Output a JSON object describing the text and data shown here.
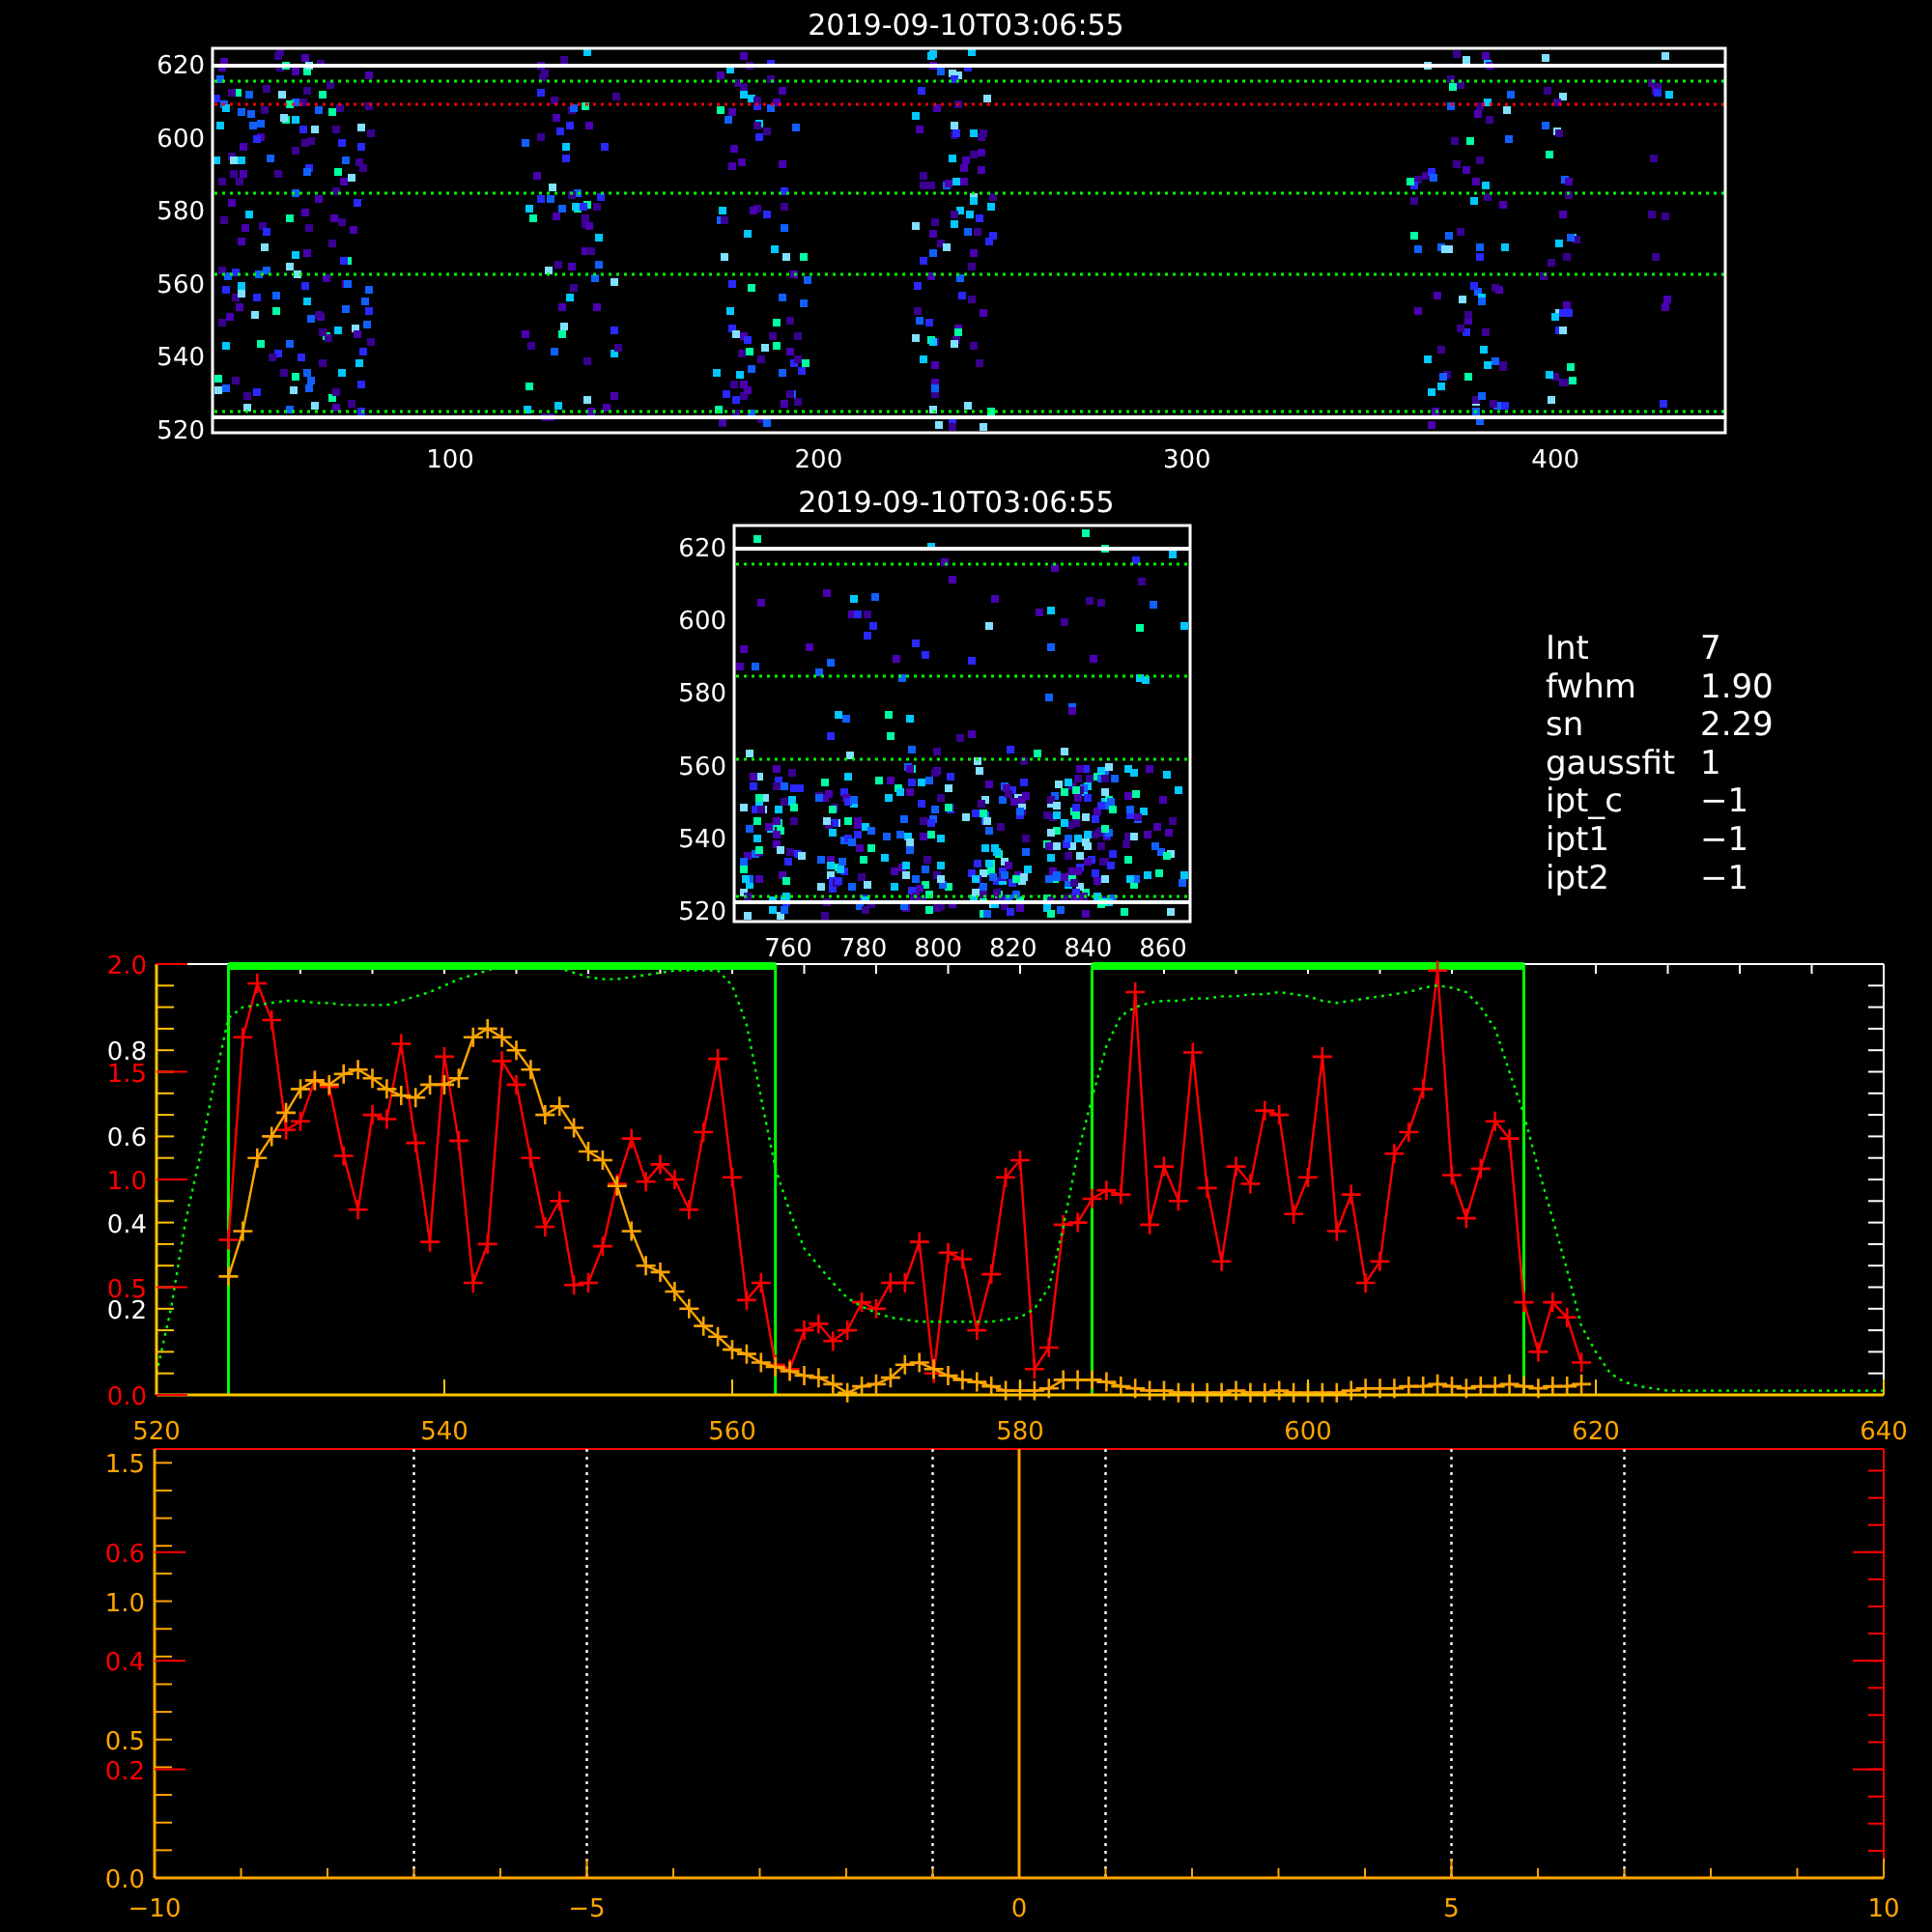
{
  "top_image": {
    "title": "2019-09-10T03:06:55",
    "x_tick_labels": [
      "100",
      "200",
      "300",
      "400"
    ],
    "y_tick_labels": [
      "620",
      "600",
      "580",
      "560",
      "540",
      "520"
    ],
    "guides": [
      {
        "color": "#ffffff",
        "kind": "solid"
      },
      {
        "color": "#00ff00",
        "kind": "dotted"
      },
      {
        "color": "#ff0000",
        "kind": "dotted"
      },
      {
        "color": "#00ff00",
        "kind": "dotted"
      },
      {
        "color": "#00ff00",
        "kind": "dotted"
      },
      {
        "color": "#00ff00",
        "kind": "dotted"
      },
      {
        "color": "#ffffff",
        "kind": "solid"
      }
    ]
  },
  "zoom_image": {
    "title": "2019-09-10T03:06:55",
    "x_tick_labels": [
      "760",
      "780",
      "800",
      "820",
      "840",
      "860"
    ],
    "y_tick_labels": [
      "620",
      "600",
      "580",
      "560",
      "540",
      "520"
    ],
    "guides": [
      {
        "color": "#ffffff",
        "kind": "solid"
      },
      {
        "color": "#00ff00",
        "kind": "dotted"
      },
      {
        "color": "#00ff00",
        "kind": "dotted"
      },
      {
        "color": "#00ff00",
        "kind": "dotted"
      },
      {
        "color": "#00ff00",
        "kind": "dotted"
      },
      {
        "color": "#ffffff",
        "kind": "solid"
      }
    ]
  },
  "fit_info": [
    {
      "label": "Int",
      "value": "7"
    },
    {
      "label": "fwhm",
      "value": "1.90"
    },
    {
      "label": "sn",
      "value": "2.29"
    },
    {
      "label": "gaussfit",
      "value": "1"
    },
    {
      "label": "ipt_c",
      "value": "−1"
    },
    {
      "label": "ipt1",
      "value": "−1"
    },
    {
      "label": "ipt2",
      "value": "−1"
    }
  ],
  "profile_plot": {
    "chart_data": {
      "type": "line",
      "xlim": [
        520,
        640
      ],
      "ylim": [
        0,
        2.0
      ],
      "y2lim": [
        0,
        1.0
      ],
      "xticks": [
        520,
        540,
        560,
        580,
        600,
        620,
        640
      ],
      "yticks": [
        {
          "value": 0,
          "label": "0.0"
        },
        {
          "value": 0.5,
          "label": "0.5"
        },
        {
          "value": 1.0,
          "label": "1.0"
        },
        {
          "value": 1.5,
          "label": "1.5"
        },
        {
          "value": 2.0,
          "label": "2.0"
        }
      ],
      "y2ticks": [
        {
          "value": 0.2,
          "label": "0.2"
        },
        {
          "value": 0.4,
          "label": "0.4"
        },
        {
          "value": 0.6,
          "label": "0.6"
        },
        {
          "value": 0.8,
          "label": "0.8"
        }
      ],
      "x": [
        520,
        521,
        522,
        523,
        524,
        525,
        526,
        527,
        528,
        529,
        530,
        531,
        532,
        533,
        534,
        535,
        536,
        537,
        538,
        539,
        540,
        541,
        542,
        543,
        544,
        545,
        546,
        547,
        548,
        549,
        550,
        551,
        552,
        553,
        554,
        555,
        556,
        557,
        558,
        559,
        560,
        561,
        562,
        563,
        564,
        565,
        566,
        567,
        568,
        569,
        570,
        571,
        572,
        573,
        574,
        575,
        576,
        577,
        578,
        579,
        580,
        581,
        582,
        583,
        584,
        585,
        586,
        587,
        588,
        589,
        590,
        591,
        592,
        593,
        594,
        595,
        596,
        597,
        598,
        599,
        600,
        601,
        602,
        603,
        604,
        605,
        606,
        607,
        608,
        609,
        610,
        611,
        612,
        613,
        614,
        615,
        616,
        617,
        618,
        619,
        620,
        621,
        622,
        623,
        624,
        625,
        626,
        627,
        628,
        629,
        630,
        631,
        632,
        633,
        634,
        635,
        636,
        637,
        638,
        639,
        640
      ],
      "series": [
        {
          "color": "#ff0000",
          "marker": "plus",
          "line_style": "solid",
          "values": [
            null,
            null,
            null,
            null,
            null,
            0.72,
            1.66,
            1.91,
            1.74,
            1.23,
            1.27,
            1.46,
            1.43,
            1.11,
            0.86,
            1.3,
            1.28,
            1.63,
            1.17,
            0.71,
            1.57,
            1.18,
            0.52,
            0.7,
            1.55,
            1.44,
            1.1,
            0.78,
            0.9,
            0.51,
            0.52,
            0.69,
            0.98,
            1.19,
            0.99,
            1.07,
            1.0,
            0.86,
            1.22,
            1.56,
            1.01,
            0.44,
            0.52,
            0.14,
            0.12,
            0.3,
            0.33,
            0.25,
            0.3,
            0.43,
            0.4,
            0.52,
            0.52,
            0.71,
            0.1,
            0.66,
            0.63,
            0.3,
            0.56,
            1.01,
            1.09,
            0.12,
            0.22,
            0.79,
            0.8,
            0.91,
            0.95,
            0.93,
            1.87,
            0.79,
            1.06,
            0.9,
            1.59,
            0.96,
            0.62,
            1.06,
            0.98,
            1.32,
            1.3,
            0.84,
            1.01,
            1.57,
            0.76,
            0.93,
            0.52,
            0.62,
            1.12,
            1.22,
            1.42,
            1.97,
            1.02,
            0.82,
            1.05,
            1.27,
            1.19,
            0.43,
            0.2,
            0.43,
            0.36,
            0.15,
            null,
            null,
            null,
            null,
            null,
            null,
            null,
            null,
            null,
            null,
            null,
            null,
            null,
            null,
            null,
            null,
            null,
            null,
            null,
            null,
            null
          ]
        },
        {
          "color": "#ffa500",
          "marker": "plus",
          "line_style": "solid",
          "values": [
            null,
            null,
            null,
            null,
            null,
            0.55,
            0.76,
            1.1,
            1.2,
            1.31,
            1.42,
            1.46,
            1.44,
            1.49,
            1.51,
            1.47,
            1.42,
            1.39,
            1.38,
            1.44,
            1.44,
            1.47,
            1.66,
            1.7,
            1.66,
            1.6,
            1.51,
            1.3,
            1.34,
            1.24,
            1.13,
            1.09,
            0.97,
            0.76,
            0.6,
            0.57,
            0.48,
            0.4,
            0.32,
            0.27,
            0.21,
            0.19,
            0.15,
            0.13,
            0.11,
            0.09,
            0.08,
            0.05,
            0.01,
            0.04,
            0.05,
            0.08,
            0.14,
            0.15,
            0.12,
            0.09,
            0.07,
            0.06,
            0.04,
            0.02,
            0.02,
            0.02,
            0.03,
            0.07,
            0.07,
            0.07,
            0.06,
            0.04,
            0.03,
            0.02,
            0.02,
            0.01,
            0.01,
            0.01,
            0.01,
            0.02,
            0.01,
            0.01,
            0.02,
            0.01,
            0.01,
            0.01,
            0.01,
            0.02,
            0.03,
            0.03,
            0.03,
            0.04,
            0.04,
            0.05,
            0.04,
            0.03,
            0.04,
            0.04,
            0.05,
            0.04,
            0.03,
            0.04,
            0.04,
            0.05,
            null,
            null,
            null,
            null,
            null,
            null,
            null,
            null,
            null,
            null,
            null,
            null,
            null,
            null,
            null,
            null,
            null,
            null,
            null,
            null,
            null
          ]
        },
        {
          "color": "#00ff00",
          "marker": "none",
          "line_style": "dotted",
          "values": [
            0.1,
            0.4,
            0.8,
            1.1,
            1.45,
            1.75,
            1.8,
            1.81,
            1.82,
            1.83,
            1.83,
            1.82,
            1.82,
            1.81,
            1.81,
            1.81,
            1.81,
            1.83,
            1.85,
            1.87,
            1.9,
            1.93,
            1.95,
            1.97,
            1.99,
            2.0,
            2.0,
            2.0,
            1.98,
            1.96,
            1.94,
            1.93,
            1.93,
            1.94,
            1.95,
            1.96,
            1.97,
            1.97,
            1.97,
            1.97,
            1.9,
            1.72,
            1.38,
            1.05,
            0.85,
            0.68,
            0.6,
            0.52,
            0.45,
            0.41,
            0.38,
            0.36,
            0.35,
            0.34,
            0.34,
            0.34,
            0.34,
            0.34,
            0.34,
            0.35,
            0.36,
            0.4,
            0.5,
            0.78,
            1.12,
            1.38,
            1.62,
            1.76,
            1.8,
            1.82,
            1.83,
            1.83,
            1.84,
            1.84,
            1.85,
            1.85,
            1.86,
            1.86,
            1.87,
            1.86,
            1.85,
            1.83,
            1.82,
            1.83,
            1.84,
            1.85,
            1.86,
            1.87,
            1.89,
            1.9,
            1.89,
            1.87,
            1.8,
            1.7,
            1.5,
            1.3,
            1.05,
            0.82,
            0.58,
            0.32,
            0.2,
            0.1,
            0.06,
            0.04,
            0.03,
            0.02,
            0.02,
            0.02,
            0.02,
            0.02,
            0.02,
            0.02,
            0.02,
            0.02,
            0.02,
            0.02,
            0.02,
            0.02,
            0.02,
            0.02,
            0.02
          ]
        }
      ],
      "ref_lines": [
        {
          "axis": "x",
          "value": 525,
          "color": "#00ff00"
        },
        {
          "axis": "x",
          "value": 563,
          "color": "#00ff00"
        },
        {
          "axis": "x",
          "value": 585,
          "color": "#00ff00"
        },
        {
          "axis": "x",
          "value": 615,
          "color": "#00ff00"
        }
      ]
    }
  },
  "offset_plot": {
    "chart_data": {
      "type": "line",
      "xlim": [
        -10,
        10
      ],
      "ylim": [
        0,
        1.55
      ],
      "y2lim": [
        0,
        0.79
      ],
      "xticks": [
        -10,
        -5,
        0,
        5,
        10
      ],
      "yticks": [
        {
          "value": 0,
          "label": "0.0"
        },
        {
          "value": 0.5,
          "label": "0.5"
        },
        {
          "value": 1.0,
          "label": "1.0"
        },
        {
          "value": 1.5,
          "label": "1.5"
        }
      ],
      "y2ticks": [
        {
          "value": 0.2,
          "label": "0.2"
        },
        {
          "value": 0.4,
          "label": "0.4"
        },
        {
          "value": 0.6,
          "label": "0.6"
        }
      ],
      "ref_lines": [
        {
          "axis": "x",
          "value": -7,
          "color": "#ffffff"
        },
        {
          "axis": "x",
          "value": -5,
          "color": "#ffffff"
        },
        {
          "axis": "x",
          "value": -1,
          "color": "#ffffff"
        },
        {
          "axis": "x",
          "value": 0,
          "color": "#ffa500"
        },
        {
          "axis": "x",
          "value": 1,
          "color": "#ffffff"
        },
        {
          "axis": "x",
          "value": 5,
          "color": "#ffffff"
        },
        {
          "axis": "x",
          "value": 7,
          "color": "#ffffff"
        }
      ]
    }
  }
}
